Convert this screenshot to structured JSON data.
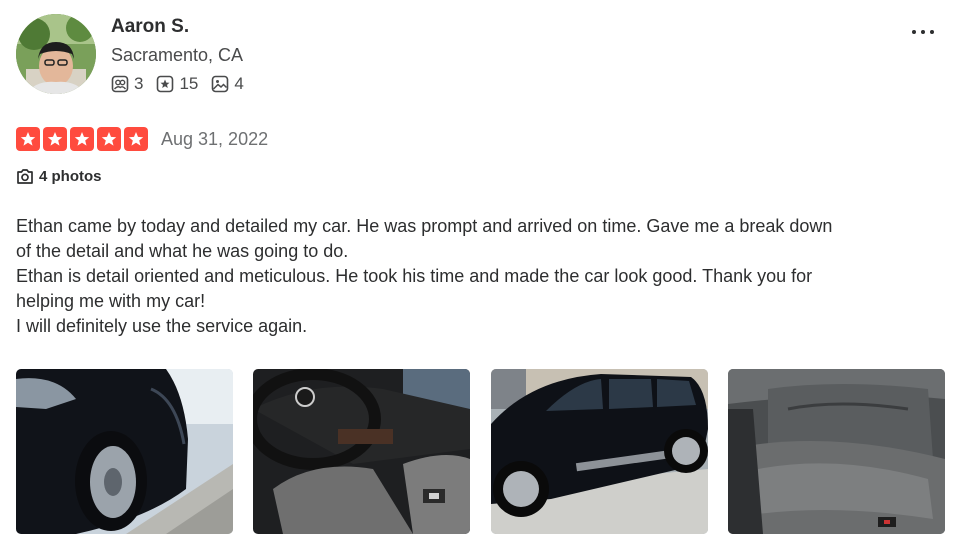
{
  "reviewer": {
    "name": "Aaron S.",
    "location": "Sacramento, CA",
    "stats": {
      "friends": "3",
      "reviews": "15",
      "photos": "4"
    }
  },
  "review": {
    "rating": 5,
    "date": "Aug 31, 2022",
    "photos_label": "4 photos",
    "paragraphs": [
      "Ethan came by today and detailed my car. He was prompt and arrived on time. Gave me a break down of the detail and what he was going to do.",
      "Ethan is detail oriented and meticulous. He took his time and made the car look good. Thank you for helping me with my car!",
      "I will definitely use the service again."
    ]
  },
  "colors": {
    "star": "#ff4b3e",
    "text": "#2d2e2f",
    "muted": "#6e7072"
  }
}
